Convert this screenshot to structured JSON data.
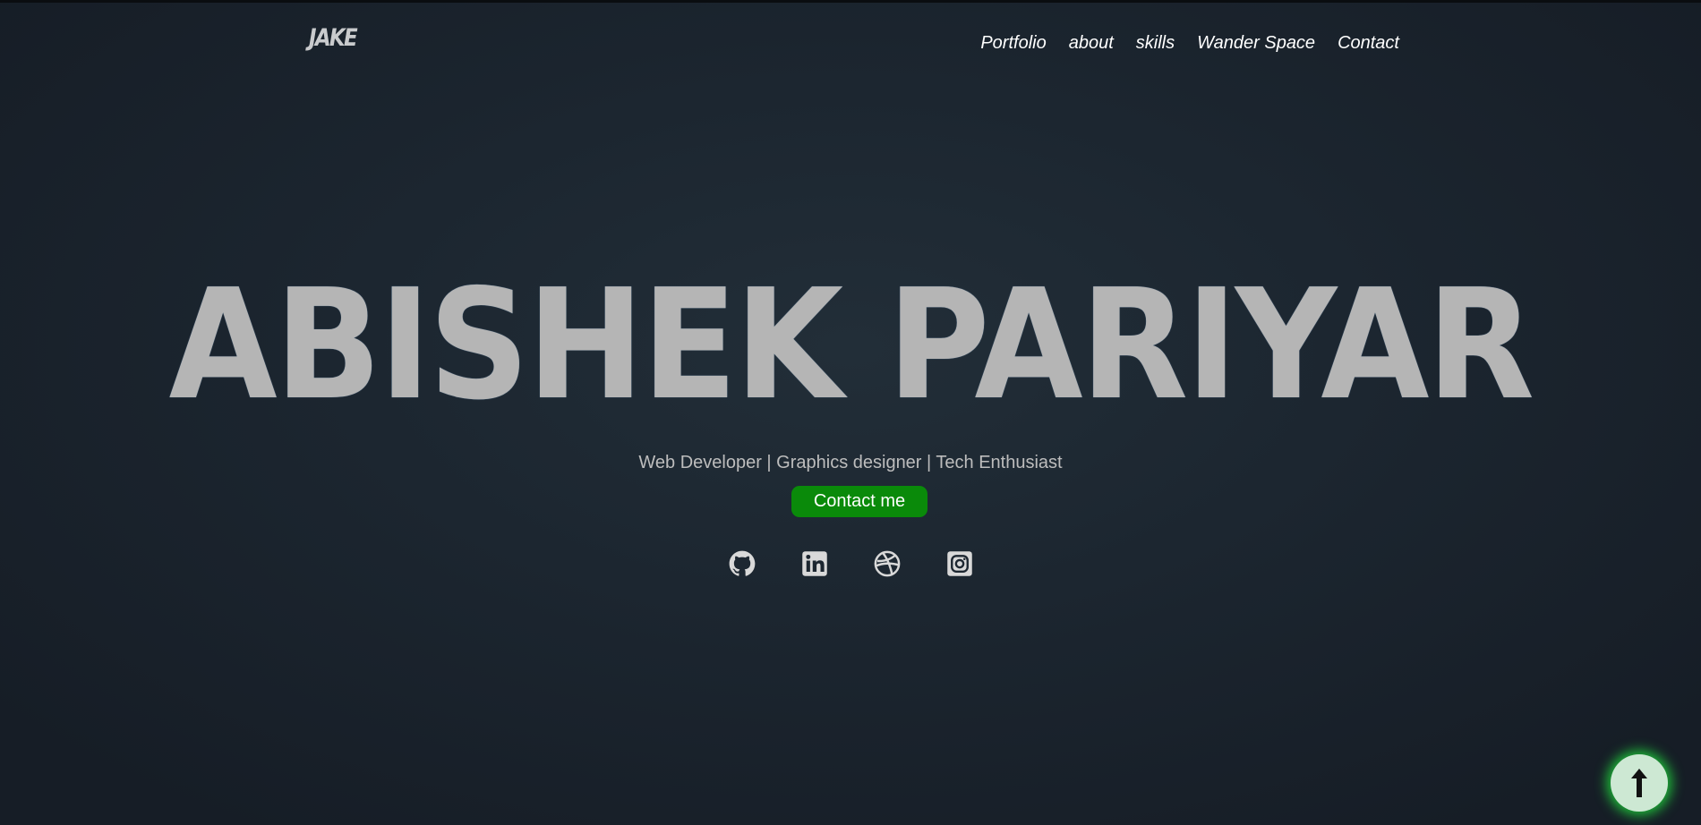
{
  "header": {
    "logo": "JAKE",
    "nav": [
      {
        "label": "Portfolio"
      },
      {
        "label": "about"
      },
      {
        "label": "skills"
      },
      {
        "label": "Wander Space"
      },
      {
        "label": "Contact"
      }
    ]
  },
  "hero": {
    "name": "ABISHEK PARIYAR",
    "subtitle": "Web Developer | Graphics designer | Tech Enthusiast",
    "cta_label": "Contact me"
  },
  "socials": [
    {
      "icon": "github-icon"
    },
    {
      "icon": "linkedin-icon"
    },
    {
      "icon": "dribbble-icon"
    },
    {
      "icon": "instagram-icon"
    }
  ],
  "scroll_top": {
    "icon": "arrow-up-icon"
  },
  "colors": {
    "background": "#1c2630",
    "name_text": "#b5b5b5",
    "cta_background": "#0a8a0a",
    "scroll_top_glow": "#1fc43a",
    "scroll_top_fill": "#cde8d3"
  }
}
